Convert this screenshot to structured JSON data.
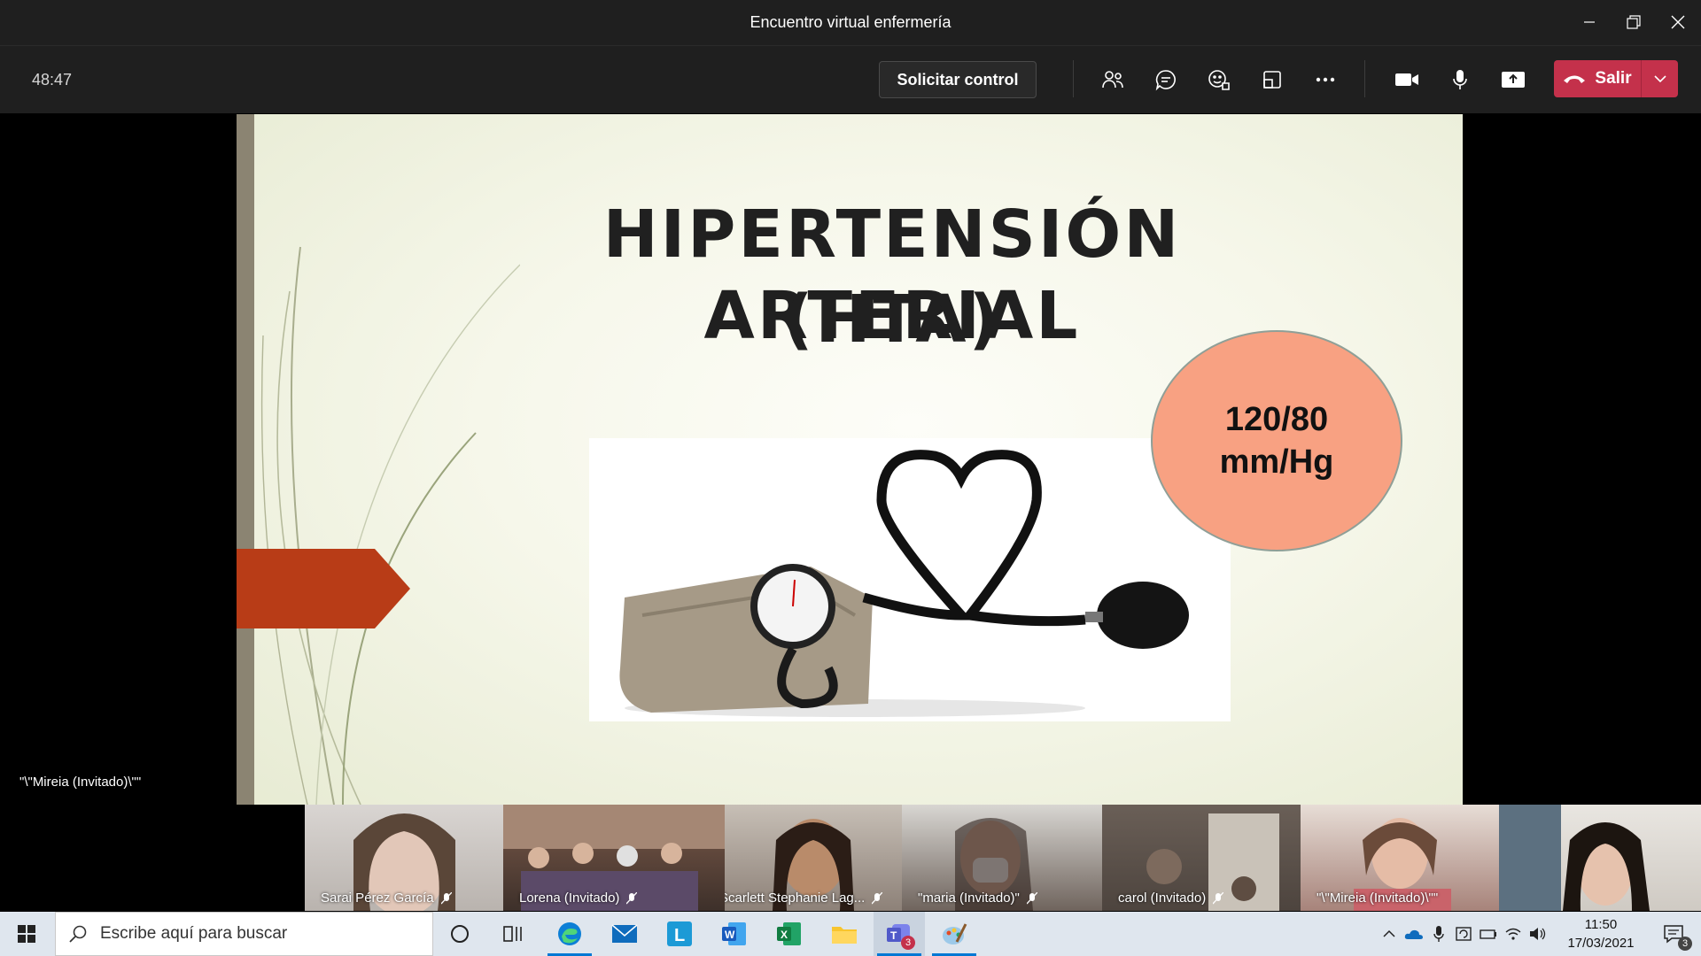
{
  "window": {
    "title": "Encuentro virtual enfermería",
    "controls": [
      "minimize-icon",
      "restore-icon",
      "close-icon"
    ]
  },
  "toolbar": {
    "timer": "48:47",
    "request_control_label": "Solicitar control",
    "icons": [
      "participants-icon",
      "chat-icon",
      "reactions-icon",
      "rooms-icon",
      "more-icon",
      "camera-icon",
      "microphone-icon",
      "share-icon"
    ],
    "leave_label": "Salir",
    "leave_color": "#c4314b"
  },
  "slide": {
    "title_line1": "HIPERTENSIÓN ARTERIAL",
    "title_line2": "(HTA)",
    "bubble_line1": "120/80",
    "bubble_line2": "mm/Hg",
    "accent_color": "#b83c17"
  },
  "stage": {
    "presenter_name": "\"\\\"Mireia (Invitado)\\\"\""
  },
  "participants": [
    {
      "name": "Sarai Pérez García",
      "muted": true
    },
    {
      "name": "Lorena (Invitado)",
      "muted": true
    },
    {
      "name": "Scarlett Stephanie Lag...",
      "muted": true
    },
    {
      "name": "\"maria (Invitado)\"",
      "muted": true
    },
    {
      "name": "carol (Invitado)",
      "muted": true
    },
    {
      "name": "\"\\\"Mireia (Invitado)\\\"\"",
      "muted": false
    },
    {
      "name": "",
      "muted": false
    }
  ],
  "taskbar": {
    "search_placeholder": "Escribe aquí para buscar",
    "apps": [
      "cortana-icon",
      "task-view-icon",
      "edge-icon",
      "mail-icon",
      "l-app-icon",
      "word-icon",
      "excel-icon",
      "file-explorer-icon",
      "teams-icon",
      "paint-icon"
    ],
    "teams_badge": "3",
    "time": "11:50",
    "date": "17/03/2021",
    "notification_badge": "3"
  }
}
